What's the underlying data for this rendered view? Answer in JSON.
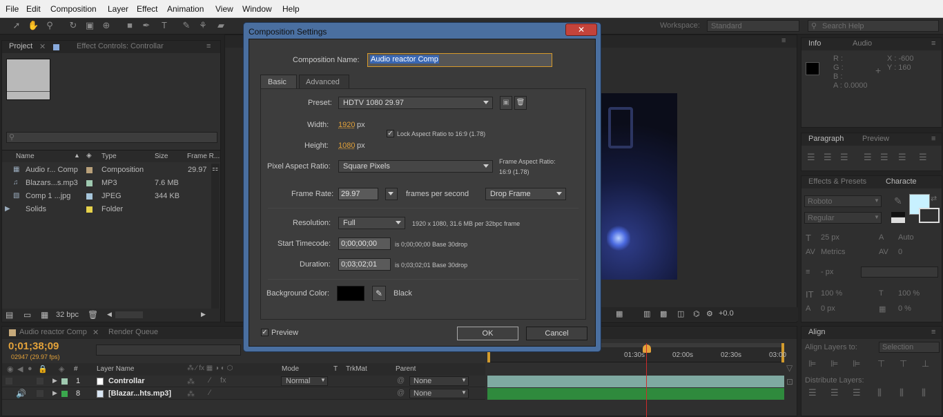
{
  "menu": [
    "File",
    "Edit",
    "Composition",
    "Layer",
    "Effect",
    "Animation",
    "View",
    "Window",
    "Help"
  ],
  "workspace": {
    "label": "Workspace:",
    "value": "Standard",
    "search_placeholder": "Search Help"
  },
  "project": {
    "tabs": [
      "Project",
      "Effect Controls: Controllar"
    ],
    "columns": [
      "Name",
      "Type",
      "Size",
      "Frame R..."
    ],
    "items": [
      {
        "name": "Audio r... Comp",
        "type": "Composition",
        "size": "",
        "fps": "29.97",
        "color": "#b8a07a"
      },
      {
        "name": "Blazars...s.mp3",
        "type": "MP3",
        "size": "7.6 MB",
        "fps": "",
        "color": "#9fc9b0"
      },
      {
        "name": "Comp 1 ...jpg",
        "type": "JPEG",
        "size": "344 KB",
        "fps": "",
        "color": "#a6c5da"
      },
      {
        "name": "Solids",
        "type": "Folder",
        "size": "",
        "fps": "",
        "color": "#e6d24b"
      }
    ],
    "bpc": "32 bpc"
  },
  "info": {
    "tabs": [
      "Info",
      "Audio"
    ],
    "r": "R :",
    "g": "G :",
    "b": "B :",
    "a": "A : 0.0000",
    "x": "X : -600",
    "y": "Y : 160"
  },
  "paragraph": {
    "tabs": [
      "Paragraph",
      "Preview"
    ]
  },
  "character": {
    "tabs": [
      "Effects & Presets",
      "Characte"
    ],
    "font": "Roboto",
    "style": "Regular",
    "size": "25 px",
    "leading": "Auto",
    "kerning": "Metrics",
    "tracking": "0",
    "stroke": "- px",
    "vscale": "100 %",
    "hscale": "100 %",
    "baseline": "0 px",
    "tsume": "0 %"
  },
  "align": {
    "tab": "Align",
    "align_to_label": "Align Layers to:",
    "align_to": "Selection",
    "distribute": "Distribute Layers:"
  },
  "viewer": {
    "offset": "+0.0"
  },
  "timeline": {
    "tabs": [
      "Audio reactor Comp",
      "Render Queue"
    ],
    "timecode": "0;01;38;09",
    "frames": "02947 (29.97 fps)",
    "columns": {
      "num": "#",
      "layer": "Layer Name",
      "mode": "Mode",
      "t": "T",
      "trkmat": "TrkMat",
      "parent": "Parent"
    },
    "ruler": [
      "01:30s",
      "02:00s",
      "02:30s",
      "03:00"
    ],
    "layers": [
      {
        "num": "1",
        "name": "Controllar",
        "mode": "Normal",
        "parent": "None",
        "color": "#9fc9b0"
      },
      {
        "num": "8",
        "name": "[Blazar...hts.mp3]",
        "mode": "",
        "parent": "None",
        "color": "#3aa84d"
      }
    ]
  },
  "dialog": {
    "title": "Composition Settings",
    "close": "✕",
    "comp_name_label": "Composition Name:",
    "comp_name": "Audio reactor Comp",
    "tabs": [
      "Basic",
      "Advanced"
    ],
    "preset_label": "Preset:",
    "preset": "HDTV 1080 29.97",
    "width_label": "Width:",
    "width": "1920",
    "height_label": "Height:",
    "height": "1080",
    "px": "px",
    "lock_label": "Lock Aspect Ratio to 16:9 (1.78)",
    "par_label": "Pixel Aspect Ratio:",
    "par": "Square Pixels",
    "far_label": "Frame Aspect Ratio:",
    "far": "16:9 (1.78)",
    "fr_label": "Frame Rate:",
    "fr": "29.97",
    "fps_label": "frames per second",
    "drop": "Drop Frame",
    "res_label": "Resolution:",
    "res": "Full",
    "res_info": "1920 x 1080, 31.6 MB per 32bpc frame",
    "start_label": "Start Timecode:",
    "start": "0;00;00;00",
    "start_info": "is 0;00;00;00  Base 30drop",
    "dur_label": "Duration:",
    "dur": "0;03;02;01",
    "dur_info": "is 0;03;02;01  Base 30drop",
    "bg_label": "Background Color:",
    "bg_name": "Black",
    "preview": "Preview",
    "ok": "OK",
    "cancel": "Cancel"
  }
}
